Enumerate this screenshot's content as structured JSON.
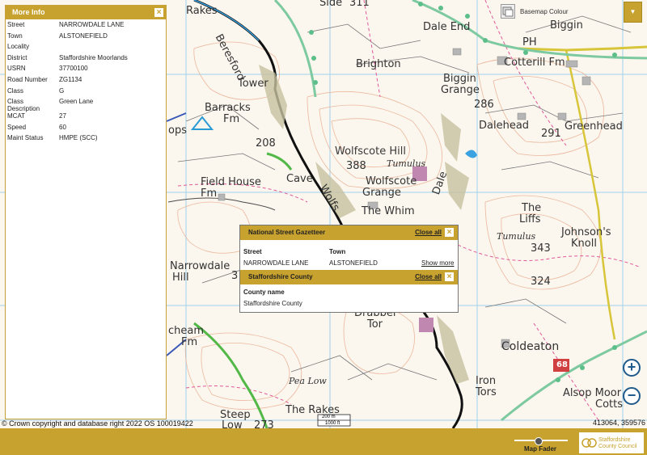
{
  "info_panel": {
    "title": "More Info",
    "close": "×",
    "fields": [
      {
        "key": "Street",
        "value": "NARROWDALE LANE"
      },
      {
        "key": "Town",
        "value": "ALSTONEFIELD"
      },
      {
        "key": "Locality",
        "value": ""
      },
      {
        "key": "District",
        "value": "Staffordshire Moorlands"
      },
      {
        "key": "USRN",
        "value": "37700100"
      },
      {
        "key": "Road Number",
        "value": "ZG1134"
      },
      {
        "key": "Class",
        "value": "G"
      },
      {
        "key": "Class Description",
        "value": "Green Lane"
      },
      {
        "key": "MCAT",
        "value": "27"
      },
      {
        "key": "Speed",
        "value": "60"
      },
      {
        "key": "Maint Status",
        "value": "HMPE (SCC)"
      }
    ]
  },
  "popup": {
    "nsg": {
      "title": "National Street Gazetteer",
      "close_all": "Close all",
      "close": "×",
      "col_street": "Street",
      "col_town": "Town",
      "street": "NARROWDALE LANE",
      "town": "ALSTONEFIELD",
      "show_more": "Show more"
    },
    "county": {
      "title": "Staffordshire County",
      "close_all": "Close all",
      "close": "×",
      "col_name": "County name",
      "name": "Staffordshire County"
    }
  },
  "basemap": {
    "label": "Basemap Colour",
    "icon": "basemap-icon"
  },
  "layer_button": {
    "icon": "chevron-down-icon",
    "glyph": "▼"
  },
  "zoom": {
    "in": "+",
    "out": "−"
  },
  "copyright": "© Crown copyright and database right 2022 OS 100019422",
  "coords": "413064, 359576",
  "scale": {
    "top": "200 m",
    "bottom": "1000 ft"
  },
  "fader": {
    "label": "Map Fader",
    "value": 0.45
  },
  "logo": {
    "line1": "Staffordshire",
    "line2": "County Council"
  },
  "map_labels": {
    "rakes": "Rakes",
    "side": "Side",
    "beresford": "Beresford",
    "tower": "Tower",
    "dale_end": "Dale End",
    "brighton": "Brighton",
    "biggin_grange_1": "Biggin",
    "biggin_grange_2": "Grange",
    "cotterill": "Cotterill Fm",
    "biggin": "Biggin",
    "ph": "PH",
    "barracks_1": "Barracks",
    "barracks_2": "Fm",
    "field_house_1": "Field House",
    "field_house_2": "Fm",
    "narrowdale_1": "Narrowdale",
    "narrowdale_2": "Hill",
    "wolfscote_hill": "Wolfscote Hill",
    "wolfscote_grange_1": "Wolfscote",
    "wolfscote_grange_2": "Grange",
    "the_whim": "The Whim",
    "cave": "Cave",
    "dalehead": "Dalehead",
    "greenhead": "Greenhead",
    "the_liffs_1": "The",
    "the_liffs_2": "Liffs",
    "johnsons_1": "Johnson's",
    "johnsons_2": "Knoll",
    "drabber": "Drabber",
    "tor": "Tor",
    "cheam_1": "cheam",
    "cheam_2": "Fm",
    "coldeaton": "Coldeaton",
    "iron_tors_1": "Iron",
    "iron_tors_2": "Tors",
    "alsop_1": "Alsop Moor",
    "alsop_2": "Cotts",
    "the_rakes": "The Rakes",
    "steep_1": "Steep",
    "steep_2": "Low",
    "pea_low": "Pea Low",
    "tumulus_1": "Tumulus",
    "tumulus_2": "Tumulus",
    "wolfs": "Wolfs",
    "dale": "Dale",
    "ops": "ops",
    "rakes_top": "Rakes",
    "h311": "311",
    "h286": "286",
    "h291": "291",
    "h388": "388",
    "h208": "208",
    "h343": "343",
    "h324": "324",
    "h273": "273",
    "h3": "3",
    "road_68": "68"
  }
}
